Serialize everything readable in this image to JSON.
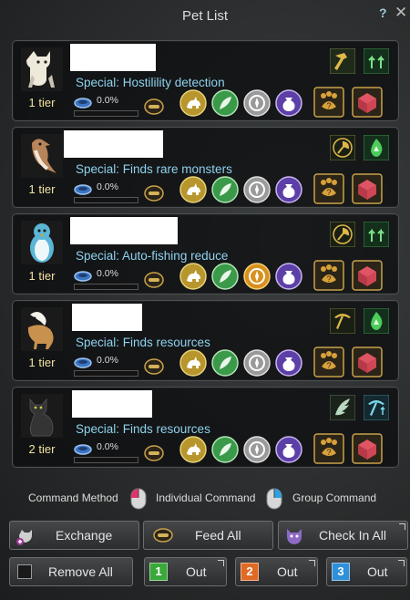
{
  "window": {
    "title": "Pet List",
    "help_label": "?",
    "close_label": "✕"
  },
  "pets": [
    {
      "tier": "1 tier",
      "special": "Special: Hostilility detection",
      "hunger": "0.0%",
      "hunger_fraction": 0.0,
      "portrait": "alpaca-pet",
      "skills": [
        "hammer-skill-icon",
        "arrows-up-skill-icon"
      ],
      "orbs": [
        "cat-command",
        "feather-command",
        "compass-command",
        "pouch-command"
      ],
      "compass_active": false
    },
    {
      "tier": "1 tier",
      "special": "Special: Finds rare monsters",
      "hunger": "0.0%",
      "hunger_fraction": 0.0,
      "portrait": "hawk-pet",
      "skills": [
        "axe-skill-icon",
        "green-flame-skill-icon"
      ],
      "orbs": [
        "cat-command",
        "feather-command",
        "compass-command",
        "pouch-command"
      ],
      "compass_active": false
    },
    {
      "tier": "1 tier",
      "special": "Special: Auto-fishing reduce",
      "hunger": "0.0%",
      "hunger_fraction": 0.0,
      "portrait": "penguin-pet",
      "skills": [
        "axe-skill-icon",
        "arrows-up-skill-icon"
      ],
      "orbs": [
        "cat-command",
        "feather-command",
        "compass-command",
        "pouch-command"
      ],
      "compass_active": true
    },
    {
      "tier": "1 tier",
      "special": "Special: Finds resources",
      "hunger": "0.0%",
      "hunger_fraction": 0.0,
      "portrait": "griffon-pet",
      "skills": [
        "pickaxe-skill-icon",
        "green-flame-skill-icon"
      ],
      "orbs": [
        "cat-command",
        "feather-command",
        "compass-command",
        "pouch-command"
      ],
      "compass_active": false
    },
    {
      "tier": "2 tier",
      "special": "Special: Finds resources",
      "hunger": "0.0%",
      "hunger_fraction": 0.0,
      "portrait": "black-cat-pet",
      "skills": [
        "wing-skill-icon",
        "pickaxe-up-skill-icon"
      ],
      "orbs": [
        "cat-command",
        "feather-command",
        "compass-command",
        "pouch-command"
      ],
      "compass_active": false
    }
  ],
  "command_method": {
    "label": "Command Method",
    "individual": "Individual Command",
    "group": "Group Command"
  },
  "buttons": {
    "exchange": "Exchange",
    "feed_all": "Feed All",
    "check_in_all": "Check In All",
    "remove_all": "Remove All",
    "out1_num": "1",
    "out1": "Out",
    "out2_num": "2",
    "out2": "Out",
    "out3_num": "3",
    "out3": "Out"
  },
  "colors": {
    "special_text": "#8fd2ee",
    "tier_text": "#f2e3a0",
    "out1_badge": "#3aa83a",
    "out2_badge": "#e06a24",
    "out3_badge": "#2f8fd8"
  }
}
